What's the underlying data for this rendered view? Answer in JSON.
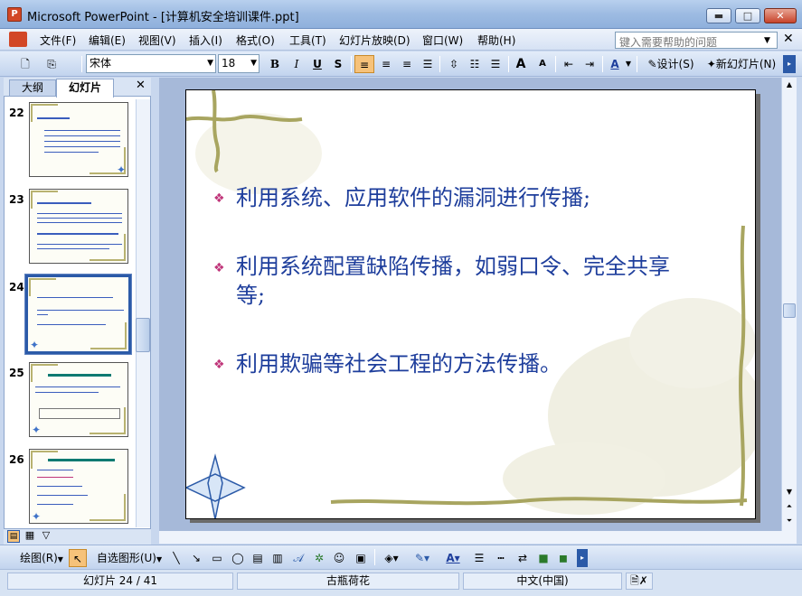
{
  "window": {
    "title": "Microsoft PowerPoint - [计算机安全培训课件.ppt]",
    "app_icon_label": "P",
    "minimize": "▬",
    "maximize": "□",
    "close": "✕"
  },
  "menu": {
    "items": [
      "文件(F)",
      "编辑(E)",
      "视图(V)",
      "插入(I)",
      "格式(O)",
      "工具(T)",
      "幻灯片放映(D)",
      "窗口(W)",
      "帮助(H)"
    ],
    "help_placeholder": "键入需要帮助的问题",
    "close_doc": "✕"
  },
  "toolbar": {
    "font_name": "宋体",
    "font_size": "18",
    "bold": "B",
    "italic": "I",
    "underline": "U",
    "shadow": "S",
    "grow_font": "A",
    "shrink_font": "A",
    "font_color": "A",
    "design_label": "设计(S)",
    "new_slide_label": "新幻灯片(N)"
  },
  "left_pane": {
    "tab_outline": "大纲",
    "tab_slides": "幻灯片",
    "close": "✕",
    "slides": [
      {
        "number": "22"
      },
      {
        "number": "23"
      },
      {
        "number": "24"
      },
      {
        "number": "25"
      },
      {
        "number": "26"
      }
    ]
  },
  "slide": {
    "bullet_symbol": "❖",
    "bullets": [
      {
        "line1": "利用系统、应用软件的漏洞进行传播;",
        "line2": ""
      },
      {
        "line1": "利用系统配置缺陷传播，如弱口令、完全共享",
        "line2": "等;"
      },
      {
        "line1": "利用欺骗等社会工程的方法传播。",
        "line2": ""
      }
    ]
  },
  "drawbar": {
    "draw_label": "绘图(R)",
    "autoshapes_label": "自选图形(U)"
  },
  "status": {
    "slide_info": "幻灯片 24 / 41",
    "design": "古瓶荷花",
    "language": "中文(中国)"
  },
  "colors": {
    "accent": "#2b5aa8",
    "bullet_text": "#1e3e9c",
    "bullet_symbol": "#c0367a"
  }
}
